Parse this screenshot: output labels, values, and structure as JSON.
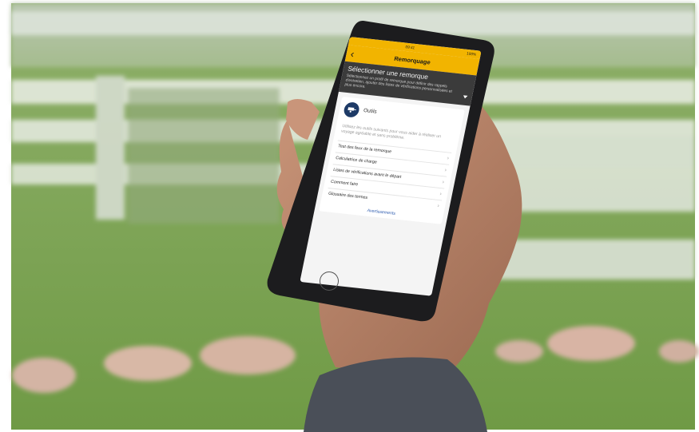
{
  "app": {
    "status": {
      "carrier": "",
      "time": "09:41",
      "battery": "100%"
    },
    "nav": {
      "title": "Remorquage",
      "back_icon": "chevron-left-icon"
    },
    "header": {
      "title": "Sélectionner une remorque",
      "description": "Sélectionnez un profil de remorque pour définir des rappels d'entretien, ajouter des listes de vérifications personnalisées et plus encore."
    },
    "card": {
      "icon": "trailer-icon",
      "title": "Outils",
      "description": "Utilisez les outils suivants pour vous aider à réaliser un voyage agréable et sans problème.",
      "items": [
        {
          "label": "Test des feux de la remorque"
        },
        {
          "label": "Calculatrice de charge"
        },
        {
          "label": "Listes de vérifications avant le départ"
        },
        {
          "label": "Comment faire"
        },
        {
          "label": "Glossaire des termes"
        }
      ],
      "footer_link": "Avertissements"
    },
    "colors": {
      "accent": "#f2b400",
      "header_bg": "#3b3b3b",
      "icon_bg": "#1d3a66",
      "link": "#2f5db0"
    }
  }
}
